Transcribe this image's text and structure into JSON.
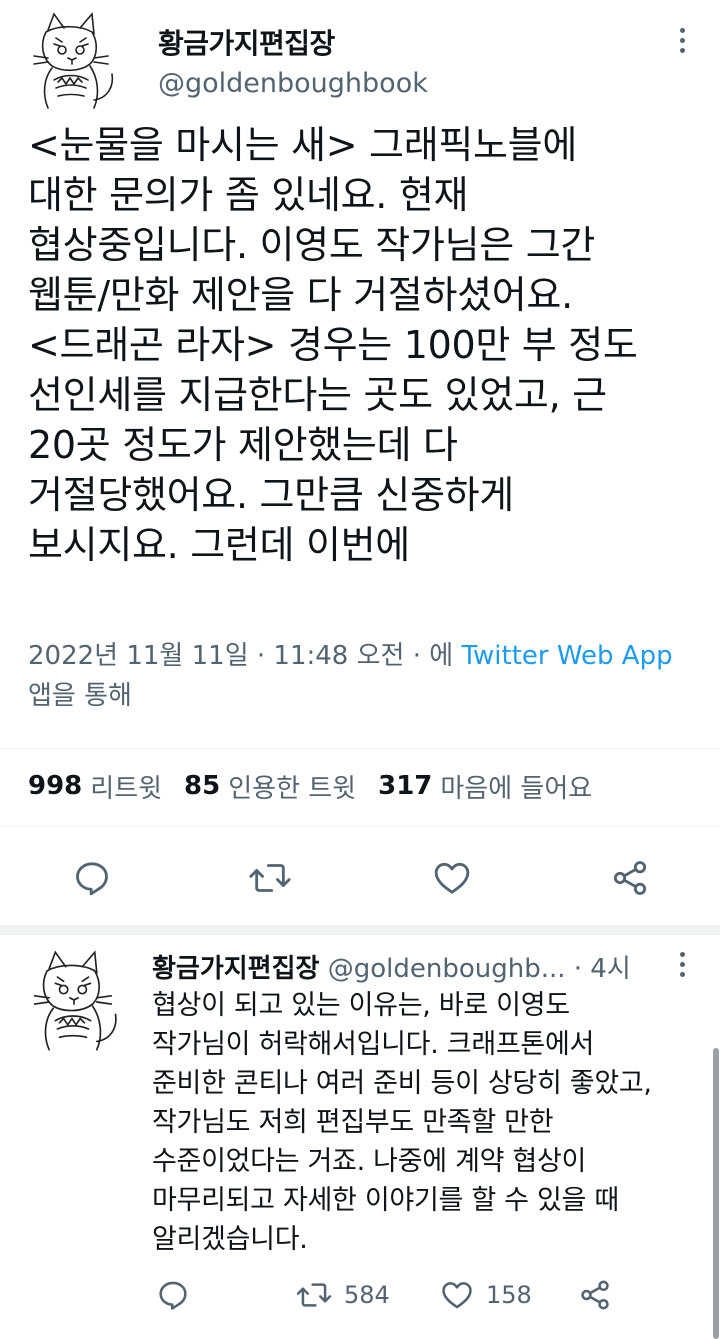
{
  "main_tweet": {
    "display_name": "황금가지편집장",
    "handle": "@goldenboughbook",
    "text_lines": [
      "<눈물을 마시는 새> 그래픽노블에",
      "대한 문의가 좀 있네요. 현재",
      "협상중입니다. 이영도 작가님은 그간",
      "웹툰/만화 제안을 다 거절하셨어요.",
      "<드래곤 라자> 경우는 100만 부 정도",
      "선인세를 지급한다는 곳도 있었고, 근",
      "20곳 정도가 제안했는데 다",
      "거절당했어요. 그만큼 신중하게",
      "보시지요. 그런데 이번에"
    ],
    "meta_prefix": "2022년 11월 11일 · 11:48 오전 · 에 ",
    "meta_source": "Twitter Web App",
    "meta_suffix": "앱을 통해",
    "stats": {
      "retweets_num": "998",
      "retweets_label": "리트윗",
      "quotes_num": "85",
      "quotes_label": "인용한 트윗",
      "likes_num": "317",
      "likes_label": "마음에 들어요"
    },
    "actions": [
      "reply-icon",
      "retweet-icon",
      "like-icon",
      "share-icon"
    ]
  },
  "reply_tweet": {
    "display_name": "황금가지편집장",
    "handle": "@goldenboughb...",
    "time": "· 4시",
    "text_lines": [
      "협상이 되고 있는 이유는, 바로 이영도",
      "작가님이 허락해서입니다. 크래프톤에서",
      "준비한 콘티나 여러 준비 등이 상당히 좋았고,",
      "작가님도 저희 편집부도 만족할 만한",
      "수준이었다는 거죠. 나중에 계약 협상이",
      "마무리되고 자세한 이야기를 할 수 있을 때",
      "알리겠습니다."
    ],
    "retweet_count": "584",
    "like_count": "158",
    "actions": [
      "reply-icon",
      "retweet-icon",
      "like-icon",
      "share-icon"
    ]
  },
  "colors": {
    "text": "#0f1419",
    "secondary": "#536471",
    "link": "#1d9bf0",
    "divider": "#eff3f4"
  }
}
